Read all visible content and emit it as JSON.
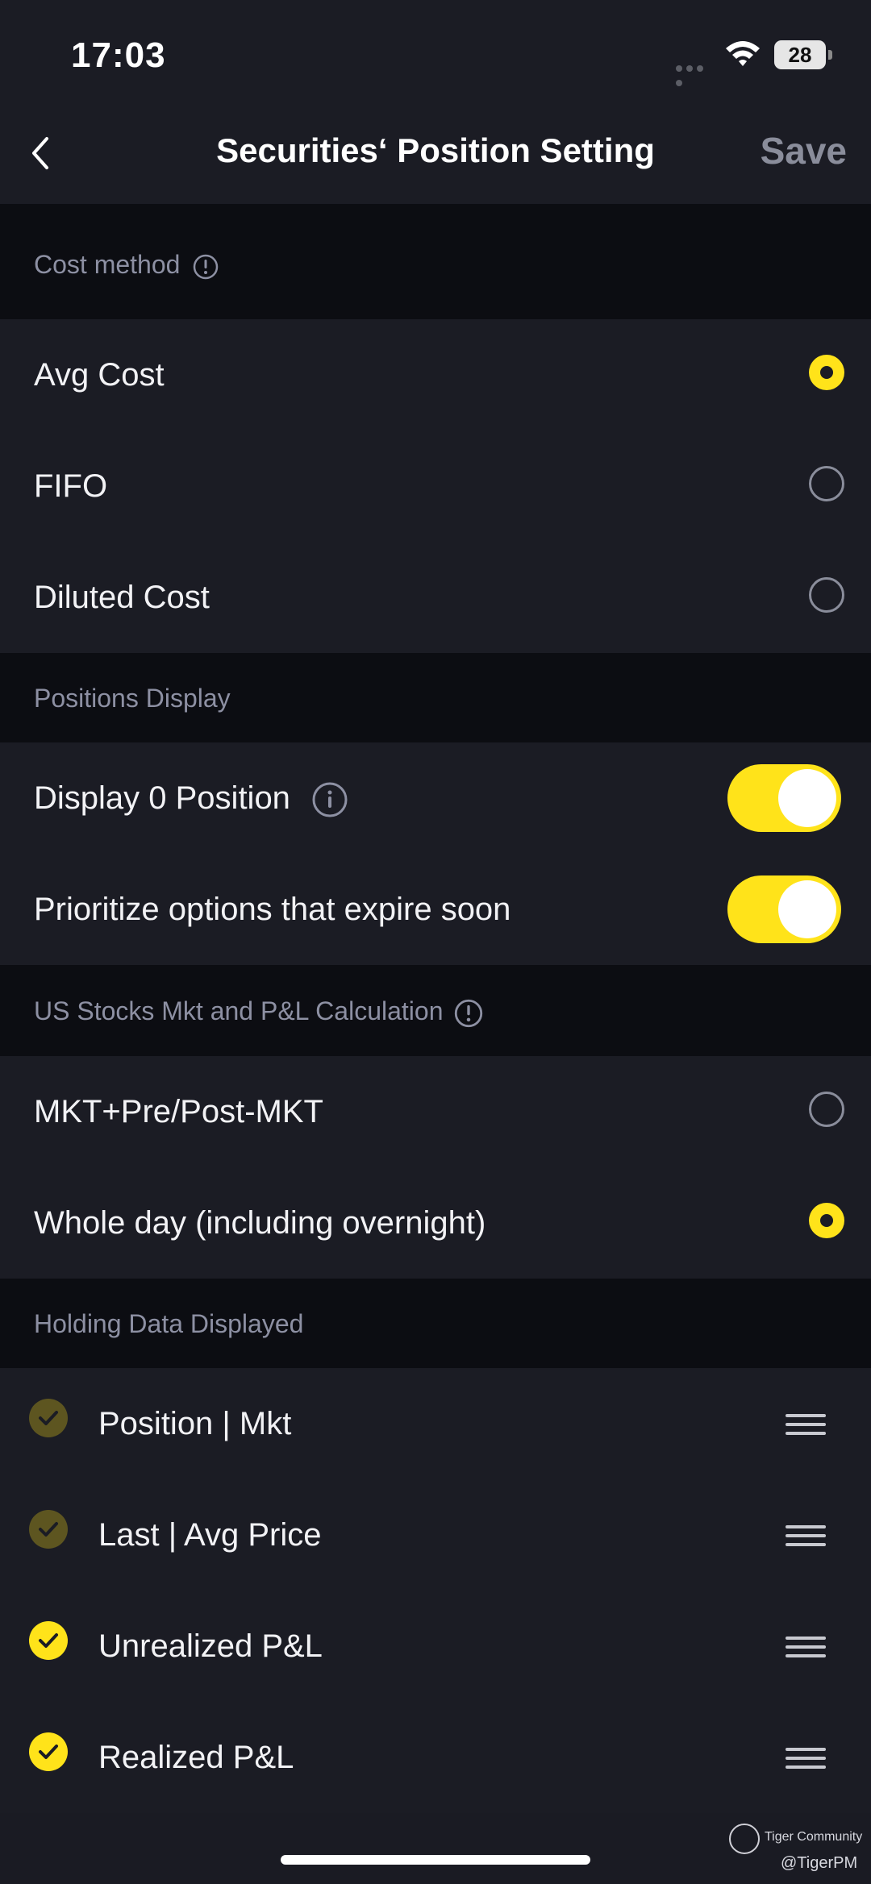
{
  "status_bar": {
    "time": "17:03",
    "battery": "28"
  },
  "nav": {
    "title": "Securities‘ Position Setting",
    "save_label": "Save"
  },
  "sections": {
    "cost_method": {
      "header": "Cost method",
      "options": [
        {
          "label": "Avg Cost",
          "selected": true
        },
        {
          "label": "FIFO",
          "selected": false
        },
        {
          "label": "Diluted Cost",
          "selected": false
        }
      ]
    },
    "positions_display": {
      "header": "Positions Display",
      "toggles": [
        {
          "label": "Display 0 Position",
          "on": true
        },
        {
          "label": "Prioritize options that expire soon",
          "on": true
        }
      ]
    },
    "us_stocks": {
      "header": "US Stocks Mkt and P&L Calculation",
      "options": [
        {
          "label": "MKT+Pre/Post-MKT",
          "selected": false
        },
        {
          "label": "Whole day (including overnight)",
          "selected": true
        }
      ]
    },
    "holding_data": {
      "header": "Holding Data Displayed",
      "items": [
        {
          "label": "Position | Mkt",
          "checked": true,
          "locked": true
        },
        {
          "label": "Last | Avg Price",
          "checked": true,
          "locked": true
        },
        {
          "label": "Unrealized P&L",
          "checked": true,
          "locked": false
        },
        {
          "label": "Realized P&L",
          "checked": true,
          "locked": false
        }
      ]
    }
  },
  "footer": {
    "brand": "Tiger Community",
    "handle": "@TigerPM"
  },
  "colors": {
    "accent": "#ffe31a",
    "accent_dim": "#5d5520",
    "background": "#1b1c24",
    "section_bg": "#0c0d12"
  }
}
